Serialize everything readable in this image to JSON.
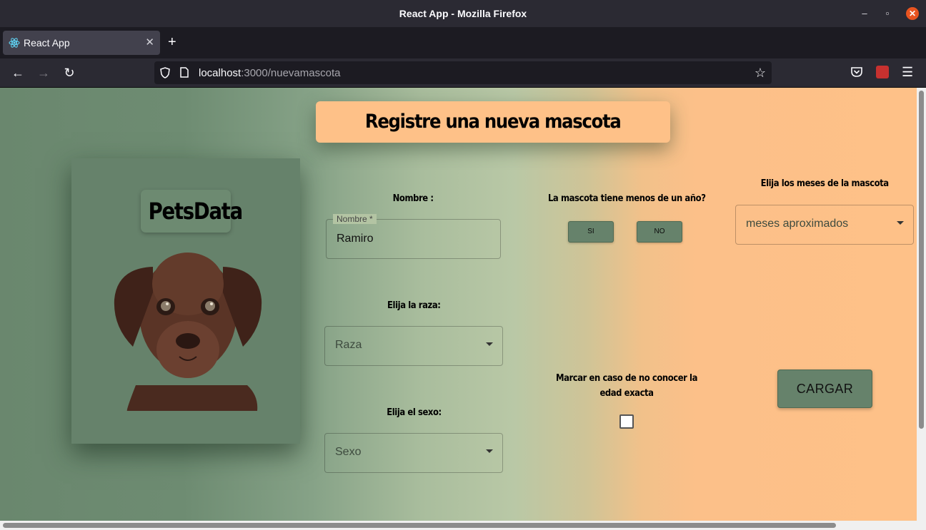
{
  "window": {
    "title": "React App - Mozilla Firefox"
  },
  "tab": {
    "label": "React App"
  },
  "url": {
    "host": "localhost",
    "rest": ":3000/nuevamascota"
  },
  "page": {
    "title": "Registre una nueva mascota",
    "logo": "PetsData",
    "name_label": "Nombre :",
    "name_field": {
      "legend": "Nombre *",
      "value": "Ramiro"
    },
    "breed_label": "Elija la raza:",
    "breed_placeholder": "Raza",
    "sex_label": "Elija el sexo:",
    "sex_placeholder": "Sexo",
    "under_year_label": "La mascota tiene menos de un año?",
    "yes_button": "SI",
    "no_button": "NO",
    "months_label": "Elija los meses de la mascota",
    "months_placeholder": "meses aproximados",
    "unknown_age_label": "Marcar en caso de no conocer la edad exacta",
    "submit_button": "CARGAR"
  },
  "colors": {
    "brand_green": "#66826b",
    "accent_peach": "#fec188"
  }
}
